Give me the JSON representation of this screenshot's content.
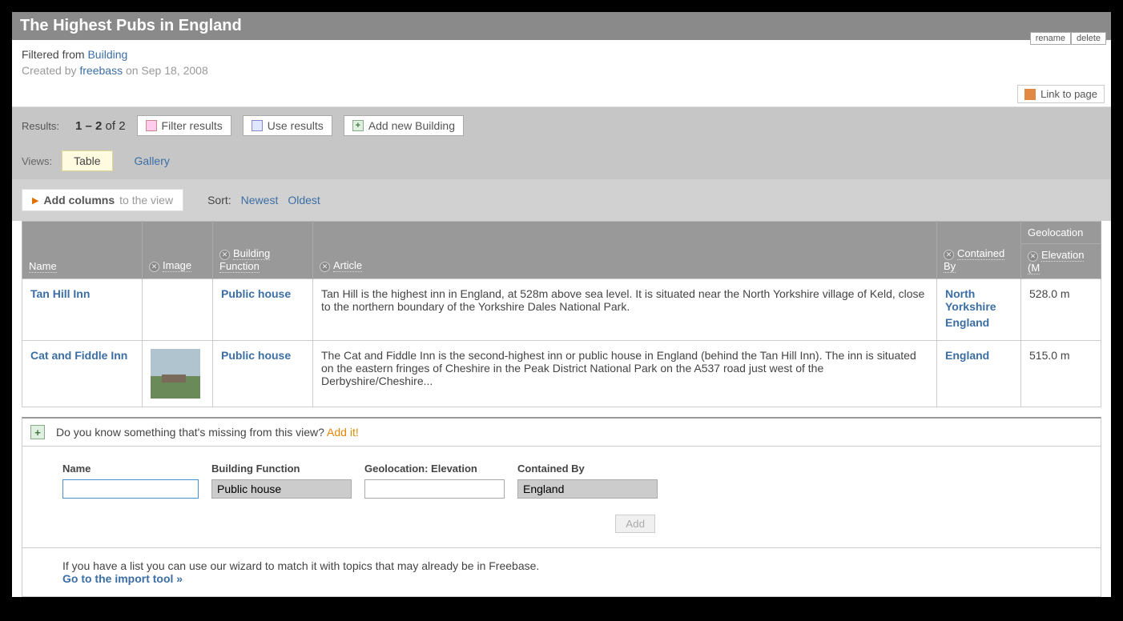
{
  "title": "The Highest Pubs in England",
  "actions": {
    "rename": "rename",
    "delete": "delete"
  },
  "meta": {
    "filtered_prefix": "Filtered from ",
    "filtered_link": "Building",
    "created_prefix": "Created by ",
    "creator": "freebass",
    "created_suffix": " on Sep 18, 2008"
  },
  "link_to_page": "Link to page",
  "toolbar": {
    "results_label": "Results:",
    "range": "1 – 2",
    "of": " of ",
    "total": "2",
    "filter": "Filter results",
    "use": "Use results",
    "add_new": "Add new Building"
  },
  "views": {
    "label": "Views:",
    "table": "Table",
    "gallery": "Gallery"
  },
  "controls": {
    "add_columns_strong": "Add columns",
    "add_columns_weak": " to the view",
    "sort_label": "Sort:",
    "newest": "Newest",
    "oldest": "Oldest"
  },
  "columns": {
    "name": "Name",
    "image": "Image",
    "func": "Building Function",
    "article": "Article",
    "contained": "Contained By",
    "geo_top": "Geolocation",
    "elevation": "Elevation (M"
  },
  "rows": [
    {
      "name": "Tan Hill Inn",
      "has_image": false,
      "func": "Public house",
      "article": "Tan Hill is the highest inn in England, at 528m above sea level. It is situated near the North Yorkshire village of Keld, close to the northern boundary of the Yorkshire Dales National Park.",
      "contained": [
        "North Yorkshire",
        "England"
      ],
      "elevation": "528.0 m"
    },
    {
      "name": "Cat and Fiddle Inn",
      "has_image": true,
      "func": "Public house",
      "article": "The Cat and Fiddle Inn is the second-highest inn or public house in England (behind the Tan Hill Inn). The inn is situated on the eastern fringes of Cheshire in the Peak District National Park on the A537 road just west of the Derbyshire/Cheshire...",
      "contained": [
        "England"
      ],
      "elevation": "515.0 m"
    }
  ],
  "add_bar": {
    "question": "Do you know something that's missing from this view? ",
    "add_it": "Add it!"
  },
  "form": {
    "name_label": "Name",
    "func_label": "Building Function",
    "func_value": "Public house",
    "geo_label": "Geolocation: Elevation",
    "cont_label": "Contained By",
    "cont_value": "England",
    "add_button": "Add"
  },
  "import": {
    "text": "If you have a list you can use our wizard to match it with topics that may already be in Freebase.",
    "link": "Go to the import tool »"
  }
}
